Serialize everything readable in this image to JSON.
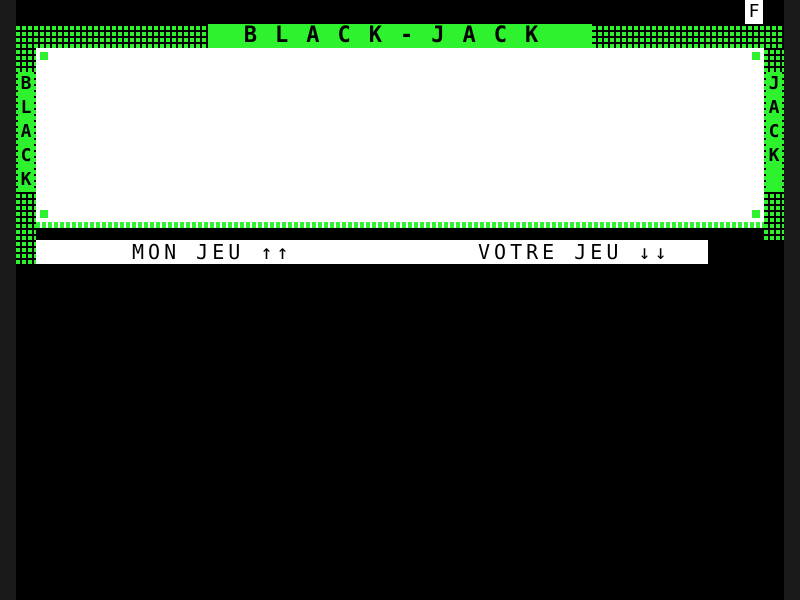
{
  "title": "BLACK-JACK",
  "left_vertical": [
    "B",
    "L",
    "A",
    "C",
    "K"
  ],
  "right_vertical": [
    "J",
    "A",
    "C",
    "K"
  ],
  "my_hand_label": "MON JEU ↑↑",
  "your_hand_label": "VOTRE JEU ↓↓",
  "status_flag": "F",
  "colors": {
    "accent": "#2ef22e",
    "panel": "#ffffff",
    "background": "#000000"
  }
}
